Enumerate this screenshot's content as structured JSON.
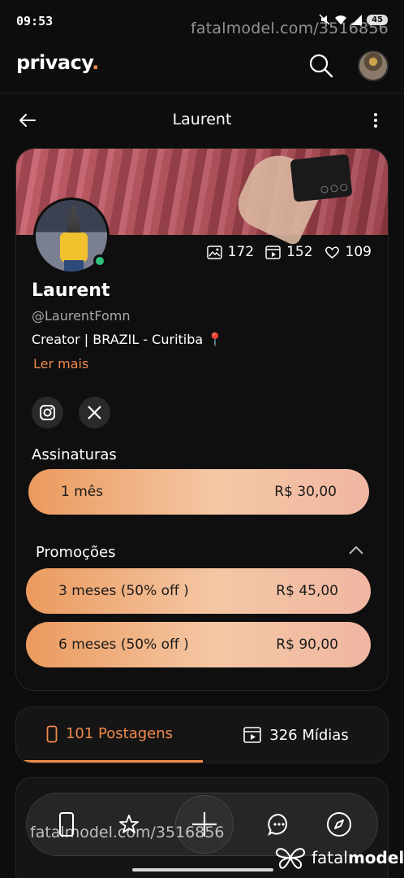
{
  "status_bar": {
    "time": "09:53",
    "battery": "45"
  },
  "watermark": {
    "top": "fatalmodel.com/3516856",
    "bottom": "fatalmodel.com/3516856"
  },
  "app": {
    "logo": "privacy",
    "logo_dot": "."
  },
  "header": {
    "title": "Laurent"
  },
  "profile": {
    "name": "Laurent",
    "handle": "@LaurentFomn",
    "bio": "Creator | BRAZIL - Curitiba 📍",
    "read_more": "Ler mais",
    "online": true,
    "stats": {
      "photos": "172",
      "videos": "152",
      "likes": "109"
    }
  },
  "subscriptions": {
    "title": "Assinaturas",
    "plans": [
      {
        "label": "1 mês",
        "price": "R$ 30,00"
      }
    ]
  },
  "promotions": {
    "title": "Promoções",
    "plans": [
      {
        "label": "3 meses (50% off )",
        "price": "R$ 45,00"
      },
      {
        "label": "6 meses (50% off )",
        "price": "R$ 90,00"
      }
    ]
  },
  "tabs": [
    {
      "label": "101 Postagens",
      "active": true
    },
    {
      "label": "326 Mídias",
      "active": false
    }
  ],
  "bottom_nav": [
    "phone-icon",
    "star-icon",
    "plus-icon",
    "chat-icon",
    "compass-icon"
  ],
  "brand_badge": {
    "text_light": "fatal",
    "text_bold": "model"
  },
  "colors": {
    "accent": "#f08a4b",
    "online": "#2ec27e",
    "background": "#0d0d0d"
  }
}
